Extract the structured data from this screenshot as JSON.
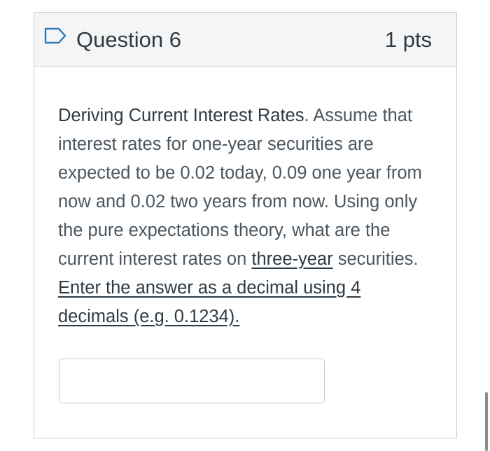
{
  "question": {
    "title": "Question 6",
    "points": "1 pts",
    "flag_icon": "flag-outline-icon",
    "body": {
      "heading": "Deriving Current Interest Rates",
      "heading_punct": ".",
      "text_1": " Assume that interest rates for one-year securities are expected to be 0.02 today, 0.09 one year from now and 0.02 two years from now. Using only the pure expectations theory, what are the current interest rates on ",
      "underline_1": "three-year",
      "text_2": " securities. ",
      "underline_2": "Enter the answer as a decimal using 4 decimals (e.g. 0.1234)."
    },
    "answer": {
      "value": "",
      "placeholder": ""
    }
  },
  "colors": {
    "header_bg": "#f5f5f5",
    "border": "#c7cdd1",
    "flag_blue": "#2b7abc",
    "text": "#2d3b45"
  }
}
